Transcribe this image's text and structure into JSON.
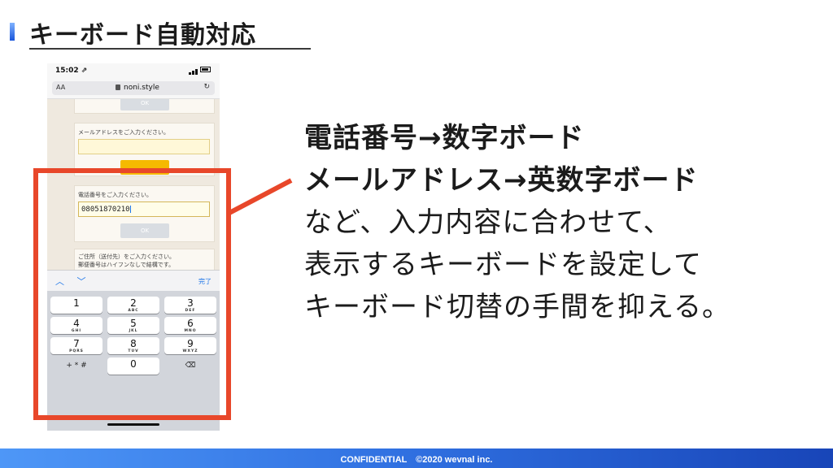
{
  "slide": {
    "title": "キーボード自動対応",
    "accent_color": "#1a56db",
    "frame_color": "#e8472a"
  },
  "phone": {
    "status_time": "15:02 ⇗",
    "url_aa": "AA",
    "url": "noni.style",
    "reload_glyph": "↻",
    "top_button": "OK",
    "mail_label": "メールアドレスをご入力ください。",
    "mail_value": "",
    "phone_label": "電話番号をご入力ください。",
    "phone_value": "08051870210",
    "phone_ok": "OK",
    "address_label_1": "ご住所（送付先）をご入力ください。",
    "address_label_2": "郵便番号はハイフンなしで結構です。",
    "toolbar_arrows": "︿ ﹀",
    "toolbar_done": "完了",
    "keys": [
      {
        "num": "1",
        "let": ""
      },
      {
        "num": "2",
        "let": "ABC"
      },
      {
        "num": "3",
        "let": "DEF"
      },
      {
        "num": "4",
        "let": "GHI"
      },
      {
        "num": "5",
        "let": "JKL"
      },
      {
        "num": "6",
        "let": "MNO"
      },
      {
        "num": "7",
        "let": "PQRS"
      },
      {
        "num": "8",
        "let": "TUV"
      },
      {
        "num": "9",
        "let": "WXYZ"
      },
      {
        "sym": "+ * #"
      },
      {
        "num": "0",
        "let": ""
      },
      {
        "sym": "⌫"
      }
    ]
  },
  "message": {
    "line1": "電話番号→数字ボード",
    "line2": "メールアドレス→英数字ボード",
    "line3": "など、入力内容に合わせて、",
    "line4": "表示するキーボードを設定して",
    "line5": "キーボード切替の手間を抑える。"
  },
  "footer": {
    "text": "CONFIDENTIAL　©2020 wevnal inc."
  }
}
